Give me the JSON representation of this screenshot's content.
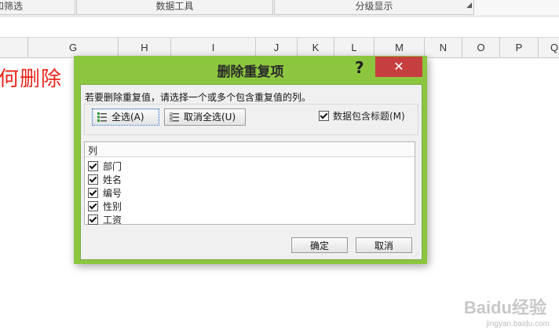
{
  "ribbon": {
    "groups": [
      "和筛选",
      "数据工具",
      "分级显示"
    ],
    "launcher_icon": "dialog-launcher-icon"
  },
  "columns": [
    "G",
    "H",
    "I",
    "J",
    "K",
    "L",
    "M",
    "N",
    "O",
    "P",
    "Q"
  ],
  "sheet_text": "何删除",
  "dialog": {
    "title": "删除重复项",
    "help": "?",
    "close": "✕",
    "instruction": "若要删除重复值，请选择一个或多个包含重复值的列。",
    "select_all": "全选(A)",
    "unselect_all": "取消全选(U)",
    "header_checkbox_label": "数据包含标题(M)",
    "header_checked": true,
    "list_header": "列",
    "columns": [
      {
        "label": "部门",
        "checked": true
      },
      {
        "label": "姓名",
        "checked": true
      },
      {
        "label": "编号",
        "checked": true
      },
      {
        "label": "性别",
        "checked": true
      },
      {
        "label": "工资",
        "checked": true
      }
    ],
    "ok": "确定",
    "cancel": "取消"
  },
  "watermark": {
    "logo": "Baidu经验",
    "url": "jingyan.baidu.com"
  },
  "colors": {
    "dialog_frame": "#8cc63f",
    "close_button": "#c63f3f",
    "sheet_text": "#e8261c"
  }
}
